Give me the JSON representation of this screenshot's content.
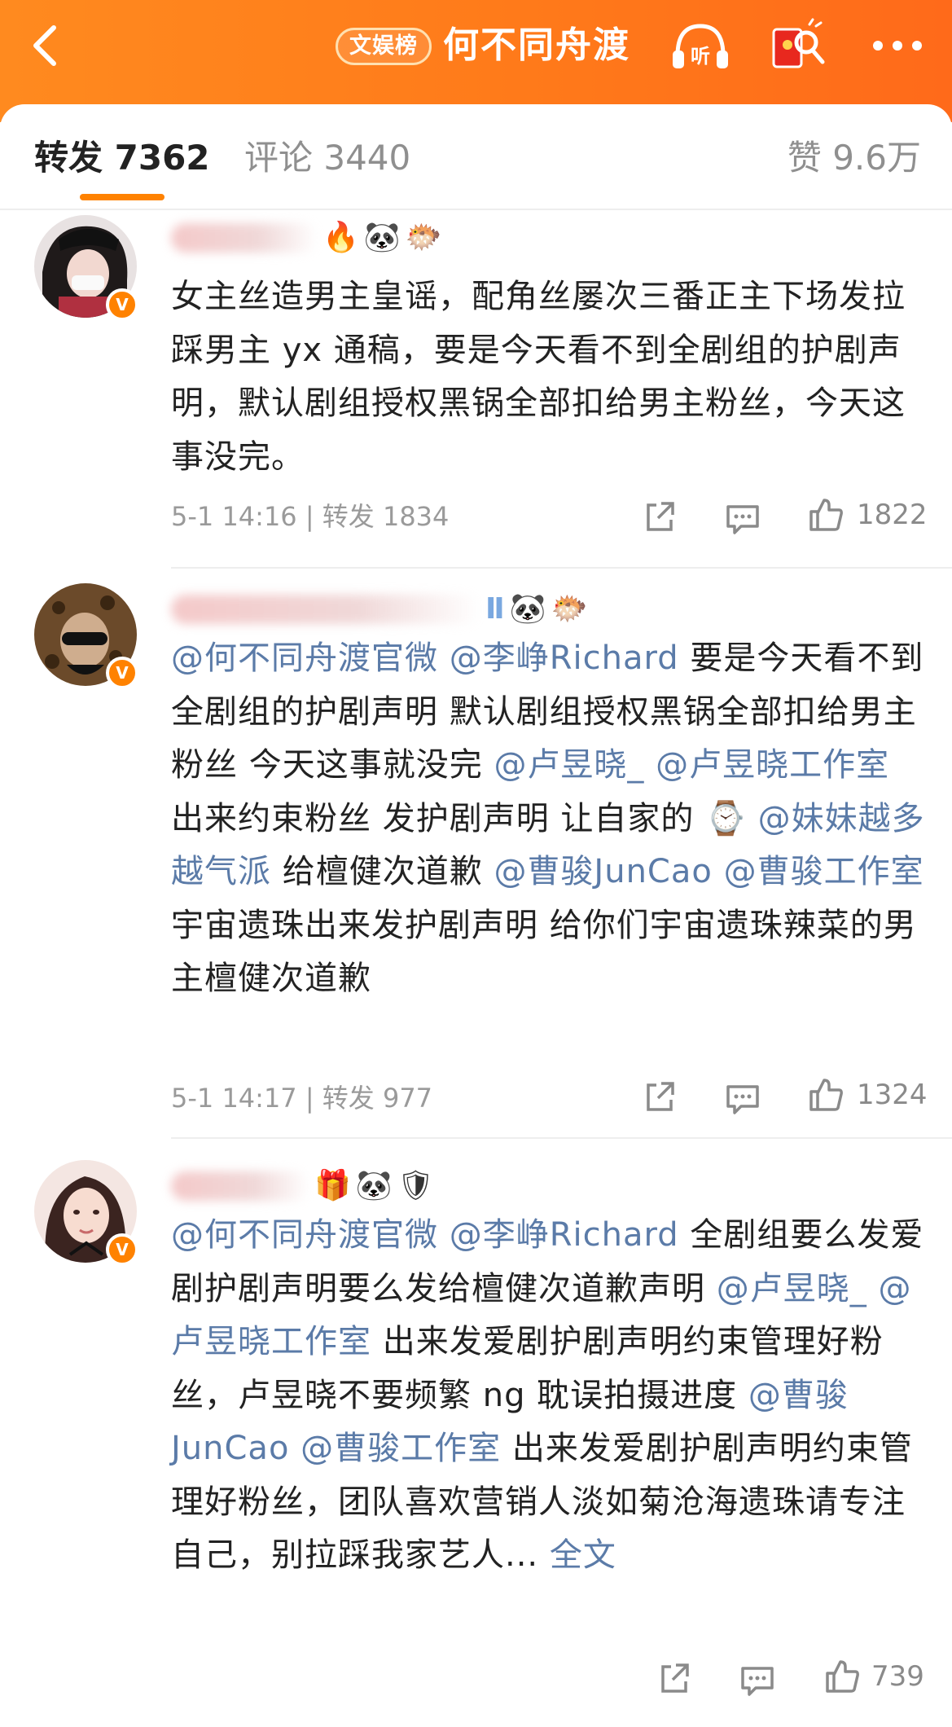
{
  "header": {
    "tag": "文娱榜",
    "title": "何不同舟渡",
    "colors": {
      "header_bg": "#ff7a1a",
      "accent": "#ff8200",
      "mention": "#5b7ba8"
    }
  },
  "tabs": {
    "repost": "转发 7362",
    "comment": "评论 3440",
    "like": "赞 9.6万"
  },
  "comments": [
    {
      "text": "女主丝造男主皇谣，配角丝屡次三番正主下场发拉踩男主 yx 通稿，要是今天看不到全剧组的护剧声明，默认剧组授权黑锅全部扣给男主粉丝，今天这事没完。",
      "meta": "5-1 14:16 | 转发 1834",
      "likes": "1822"
    },
    {
      "parts": [
        {
          "t": "@何不同舟渡官微",
          "m": true
        },
        {
          "t": " ",
          "m": false
        },
        {
          "t": "@李峥Richard",
          "m": true
        },
        {
          "t": " 要是今天看不到全剧组的护剧声明 默认剧组授权黑锅全部扣给男主粉丝 今天这事就没完 ",
          "m": false
        },
        {
          "t": "@卢昱晓_",
          "m": true
        },
        {
          "t": " ",
          "m": false
        },
        {
          "t": "@卢昱晓工作室",
          "m": true
        },
        {
          "t": " 出来约束粉丝 发护剧声明  让自家的 ⌚ ",
          "m": false
        },
        {
          "t": "@妹妹越多越气派",
          "m": true
        },
        {
          "t": " 给檀健次道歉 ",
          "m": false
        },
        {
          "t": "@曹骏JunCao",
          "m": true
        },
        {
          "t": " ",
          "m": false
        },
        {
          "t": "@曹骏工作室",
          "m": true
        },
        {
          "t": " 宇宙遗珠出来发护剧声明 给你们宇宙遗珠辣菜的男主檀健次道歉",
          "m": false
        }
      ],
      "meta": "5-1 14:17 | 转发 977",
      "likes": "1324"
    },
    {
      "parts": [
        {
          "t": "@何不同舟渡官微",
          "m": true
        },
        {
          "t": " ",
          "m": false
        },
        {
          "t": "@李峥Richard",
          "m": true
        },
        {
          "t": " 全剧组要么发爱剧护剧声明要么发给檀健次道歉声明  ",
          "m": false
        },
        {
          "t": "@卢昱晓_",
          "m": true
        },
        {
          "t": " ",
          "m": false
        },
        {
          "t": "@卢昱晓工作室",
          "m": true
        },
        {
          "t": "  出来发爱剧护剧声明约束管理好粉丝，卢昱晓不要频繁 ng 耽误拍摄进度  ",
          "m": false
        },
        {
          "t": "@曹骏JunCao",
          "m": true
        },
        {
          "t": " ",
          "m": false
        },
        {
          "t": "@曹骏工作室",
          "m": true
        },
        {
          "t": " 出来发爱剧护剧声明约束管理好粉丝，团队喜欢营销人淡如菊沧海遗珠请专注自己，别拉踩我家艺人... ",
          "m": false
        }
      ],
      "more": "全文",
      "likes": "739"
    }
  ]
}
